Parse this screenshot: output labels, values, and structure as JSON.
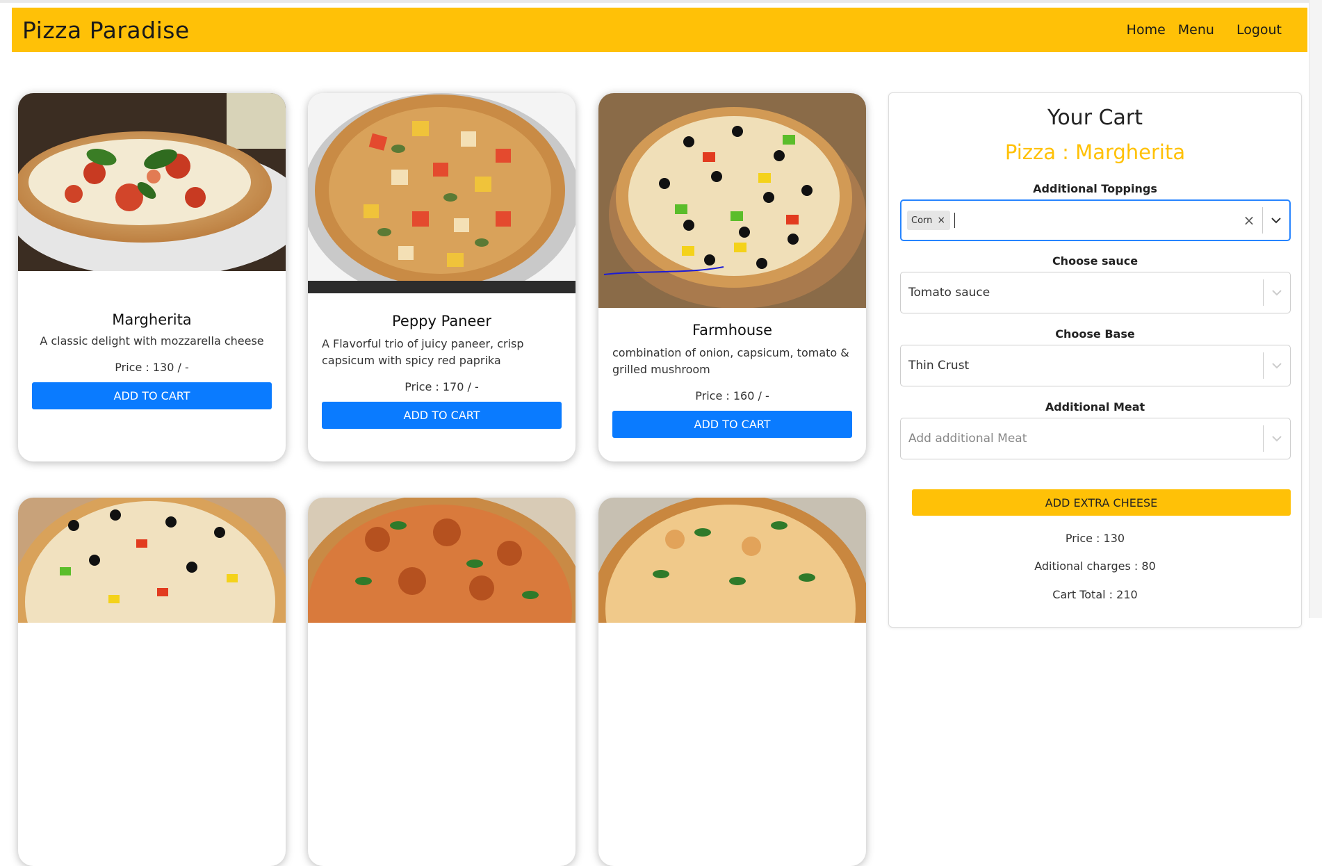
{
  "brand": "Pizza Paradise",
  "nav": {
    "home": "Home",
    "menu": "Menu",
    "logout": "Logout"
  },
  "products": [
    {
      "name": "Margherita",
      "description": "A classic delight with mozzarella cheese",
      "price": "Price : 130 / -",
      "button": "ADD TO CART"
    },
    {
      "name": "Peppy Paneer",
      "description": "A Flavorful trio of juicy paneer, crisp capsicum with spicy red paprika",
      "price": "Price : 170 / -",
      "button": "ADD TO CART"
    },
    {
      "name": "Farmhouse",
      "description": "combination of onion, capsicum, tomato & grilled mushroom",
      "price": "Price : 160 / -",
      "button": "ADD TO CART"
    }
  ],
  "cart": {
    "title": "Your Cart",
    "pizza": "Pizza : Margherita",
    "toppings_label": "Additional Toppings",
    "toppings_selected": [
      "Corn"
    ],
    "sauce_label": "Choose sauce",
    "sauce_value": "Tomato sauce",
    "base_label": "Choose Base",
    "base_value": "Thin Crust",
    "meat_label": "Additional Meat",
    "meat_placeholder": "Add additional Meat",
    "cheese_button": "ADD EXTRA CHEESE",
    "price": "Price : 130",
    "additional": "Aditional charges : 80",
    "total": "Cart Total : 210"
  },
  "colors": {
    "accent": "#ffc107",
    "primary": "#0a7bff",
    "focus": "#2684ff"
  }
}
